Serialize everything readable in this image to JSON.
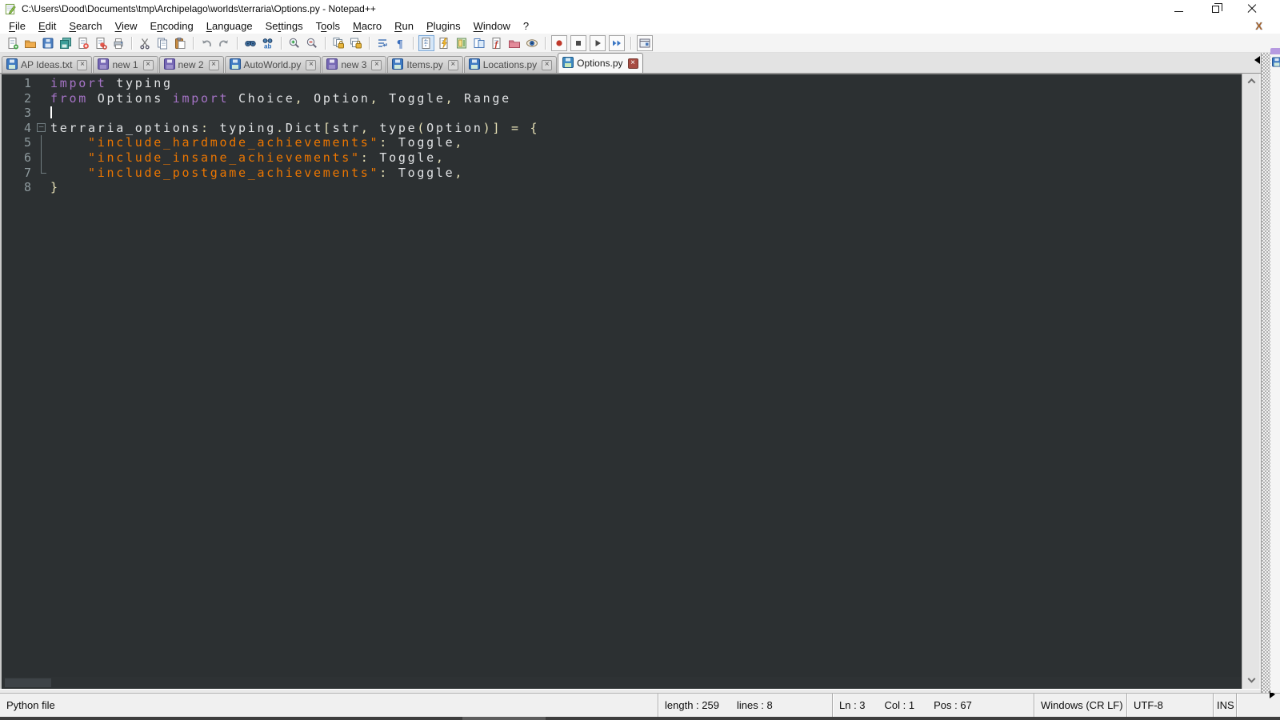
{
  "window": {
    "title": "C:\\Users\\Dood\\Documents\\tmp\\Archipelago\\worlds\\terraria\\Options.py - Notepad++",
    "menu_close_x": "X"
  },
  "menu": {
    "items": [
      {
        "label": "File",
        "u": 0
      },
      {
        "label": "Edit",
        "u": 0
      },
      {
        "label": "Search",
        "u": 0
      },
      {
        "label": "View",
        "u": 0
      },
      {
        "label": "Encoding",
        "u": 1
      },
      {
        "label": "Language",
        "u": 0
      },
      {
        "label": "Settings",
        "u": 2
      },
      {
        "label": "Tools",
        "u": 1
      },
      {
        "label": "Macro",
        "u": 0
      },
      {
        "label": "Run",
        "u": 0
      },
      {
        "label": "Plugins",
        "u": 0
      },
      {
        "label": "Window",
        "u": 0
      },
      {
        "label": "?",
        "u": null
      }
    ]
  },
  "toolbar": {
    "groups": [
      [
        {
          "name": "new-file"
        },
        {
          "name": "open"
        },
        {
          "name": "save"
        },
        {
          "name": "save-all"
        },
        {
          "name": "close"
        },
        {
          "name": "close-all"
        },
        {
          "name": "print"
        }
      ],
      [
        {
          "name": "cut"
        },
        {
          "name": "copy"
        },
        {
          "name": "paste"
        }
      ],
      [
        {
          "name": "undo"
        },
        {
          "name": "redo"
        }
      ],
      [
        {
          "name": "find"
        },
        {
          "name": "replace"
        }
      ],
      [
        {
          "name": "zoom-in"
        },
        {
          "name": "zoom-out"
        }
      ],
      [
        {
          "name": "sync-v"
        },
        {
          "name": "sync-h"
        }
      ],
      [
        {
          "name": "wrap"
        },
        {
          "name": "show-symbols"
        }
      ],
      [
        {
          "name": "indent-guide",
          "pressed": true
        },
        {
          "name": "run-lightning"
        },
        {
          "name": "doc-map"
        },
        {
          "name": "doc-list"
        },
        {
          "name": "function-list"
        },
        {
          "name": "folder-workspace"
        },
        {
          "name": "monitor-eye"
        }
      ],
      [
        {
          "name": "macro-record",
          "boxed": true
        },
        {
          "name": "macro-stop",
          "boxed": true
        },
        {
          "name": "macro-play",
          "boxed": true
        },
        {
          "name": "macro-multi",
          "boxed": true
        }
      ],
      [
        {
          "name": "macro-panel",
          "boxed": true
        }
      ]
    ]
  },
  "tabs": [
    {
      "label": "AP Ideas.txt",
      "state": "saved",
      "active": false
    },
    {
      "label": "new 1",
      "state": "new",
      "active": false
    },
    {
      "label": "new 2",
      "state": "new",
      "active": false
    },
    {
      "label": "AutoWorld.py",
      "state": "saved",
      "active": false
    },
    {
      "label": "new 3",
      "state": "new",
      "active": false
    },
    {
      "label": "Items.py",
      "state": "saved",
      "active": false
    },
    {
      "label": "Locations.py",
      "state": "saved",
      "active": false
    },
    {
      "label": "Options.py",
      "state": "saved",
      "active": true
    }
  ],
  "editor": {
    "lines": [
      {
        "num": "1",
        "fold": null,
        "caret": false,
        "tokens": [
          {
            "t": "kw",
            "s": "import"
          },
          {
            "t": "id",
            "s": " typing"
          }
        ]
      },
      {
        "num": "2",
        "fold": null,
        "caret": false,
        "tokens": [
          {
            "t": "kw",
            "s": "from"
          },
          {
            "t": "id",
            "s": " Options "
          },
          {
            "t": "kw",
            "s": "import"
          },
          {
            "t": "id",
            "s": " Choice"
          },
          {
            "t": "op",
            "s": ","
          },
          {
            "t": "id",
            "s": " Option"
          },
          {
            "t": "op",
            "s": ","
          },
          {
            "t": "id",
            "s": " Toggle"
          },
          {
            "t": "op",
            "s": ","
          },
          {
            "t": "id",
            "s": " Range"
          }
        ]
      },
      {
        "num": "3",
        "fold": null,
        "caret": true,
        "tokens": []
      },
      {
        "num": "4",
        "fold": "box",
        "caret": false,
        "tokens": [
          {
            "t": "id",
            "s": "terraria_options"
          },
          {
            "t": "op",
            "s": ":"
          },
          {
            "t": "id",
            "s": " typing"
          },
          {
            "t": "op",
            "s": "."
          },
          {
            "t": "id",
            "s": "Dict"
          },
          {
            "t": "op",
            "s": "["
          },
          {
            "t": "id",
            "s": "str"
          },
          {
            "t": "op",
            "s": ","
          },
          {
            "t": "id",
            "s": " type"
          },
          {
            "t": "op",
            "s": "("
          },
          {
            "t": "id",
            "s": "Option"
          },
          {
            "t": "op",
            "s": ")"
          },
          {
            "t": "op",
            "s": "]"
          },
          {
            "t": "op",
            "s": " = {"
          }
        ]
      },
      {
        "num": "5",
        "fold": "bar",
        "caret": false,
        "tokens": [
          {
            "t": "id",
            "s": "    "
          },
          {
            "t": "str",
            "s": "\"include_hardmode_achievements\""
          },
          {
            "t": "op",
            "s": ":"
          },
          {
            "t": "id",
            "s": " Toggle"
          },
          {
            "t": "op",
            "s": ","
          }
        ]
      },
      {
        "num": "6",
        "fold": "bar",
        "caret": false,
        "tokens": [
          {
            "t": "id",
            "s": "    "
          },
          {
            "t": "str",
            "s": "\"include_insane_achievements\""
          },
          {
            "t": "op",
            "s": ":"
          },
          {
            "t": "id",
            "s": " Toggle"
          },
          {
            "t": "op",
            "s": ","
          }
        ]
      },
      {
        "num": "7",
        "fold": "end",
        "caret": false,
        "tokens": [
          {
            "t": "id",
            "s": "    "
          },
          {
            "t": "str",
            "s": "\"include_postgame_achievements\""
          },
          {
            "t": "op",
            "s": ":"
          },
          {
            "t": "id",
            "s": " Toggle"
          },
          {
            "t": "op",
            "s": ","
          }
        ]
      },
      {
        "num": "8",
        "fold": null,
        "caret": false,
        "tokens": [
          {
            "t": "op",
            "s": "}"
          }
        ]
      }
    ]
  },
  "status": {
    "doc_type": "Python file",
    "length_label": "length : 259",
    "lines_label": "lines : 8",
    "ln": "Ln : 3",
    "col": "Col : 1",
    "pos": "Pos : 67",
    "eol": "Windows (CR LF)",
    "encoding": "UTF-8",
    "ins": "INS"
  },
  "colors": {
    "editor_bg": "#2c3032",
    "gutter_text": "#8e9a9e",
    "keyword": "#a573c6",
    "identifier": "#e0e2e4",
    "operator": "#e8e2b7",
    "string": "#ec7600",
    "caret": "#ffffff",
    "fold_guide": "#707c81",
    "sliver_tab": "#b69ae0"
  }
}
